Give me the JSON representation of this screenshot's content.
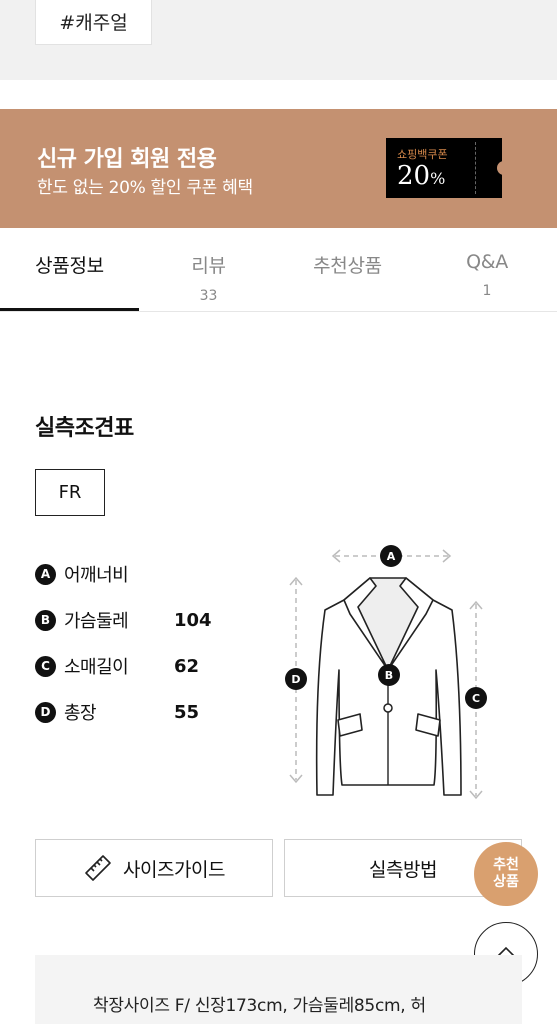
{
  "tag": {
    "label": "#캐주얼"
  },
  "banner": {
    "bg": "#c49171",
    "title": "신규 가입 회원 전용",
    "subtitle": "한도 없는 20% 할인 쿠폰 혜택",
    "coupon_label": "쇼핑백쿠폰",
    "coupon_value": "20",
    "coupon_unit": "%"
  },
  "tabs": [
    {
      "label": "상품정보",
      "count": ""
    },
    {
      "label": "리뷰",
      "count": "33"
    },
    {
      "label": "추천상품",
      "count": ""
    },
    {
      "label": "Q&A",
      "count": "1"
    }
  ],
  "size_chart": {
    "title": "실측조견표",
    "size": "FR",
    "measurements": [
      {
        "badge": "A",
        "label": "어깨너비",
        "value": ""
      },
      {
        "badge": "B",
        "label": "가슴둘레",
        "value": "104"
      },
      {
        "badge": "C",
        "label": "소매길이",
        "value": "62"
      },
      {
        "badge": "D",
        "label": "총장",
        "value": "55"
      }
    ],
    "diagram_badges": {
      "a": "A",
      "b": "B",
      "c": "C",
      "d": "D"
    }
  },
  "buttons": {
    "size_guide": "사이즈가이드",
    "measure_method": "실측방법"
  },
  "fab": {
    "recommend_line1": "추천",
    "recommend_line2": "상품"
  },
  "model_info": "착장사이즈 F/ 신장173cm, 가슴둘레85cm, 허"
}
